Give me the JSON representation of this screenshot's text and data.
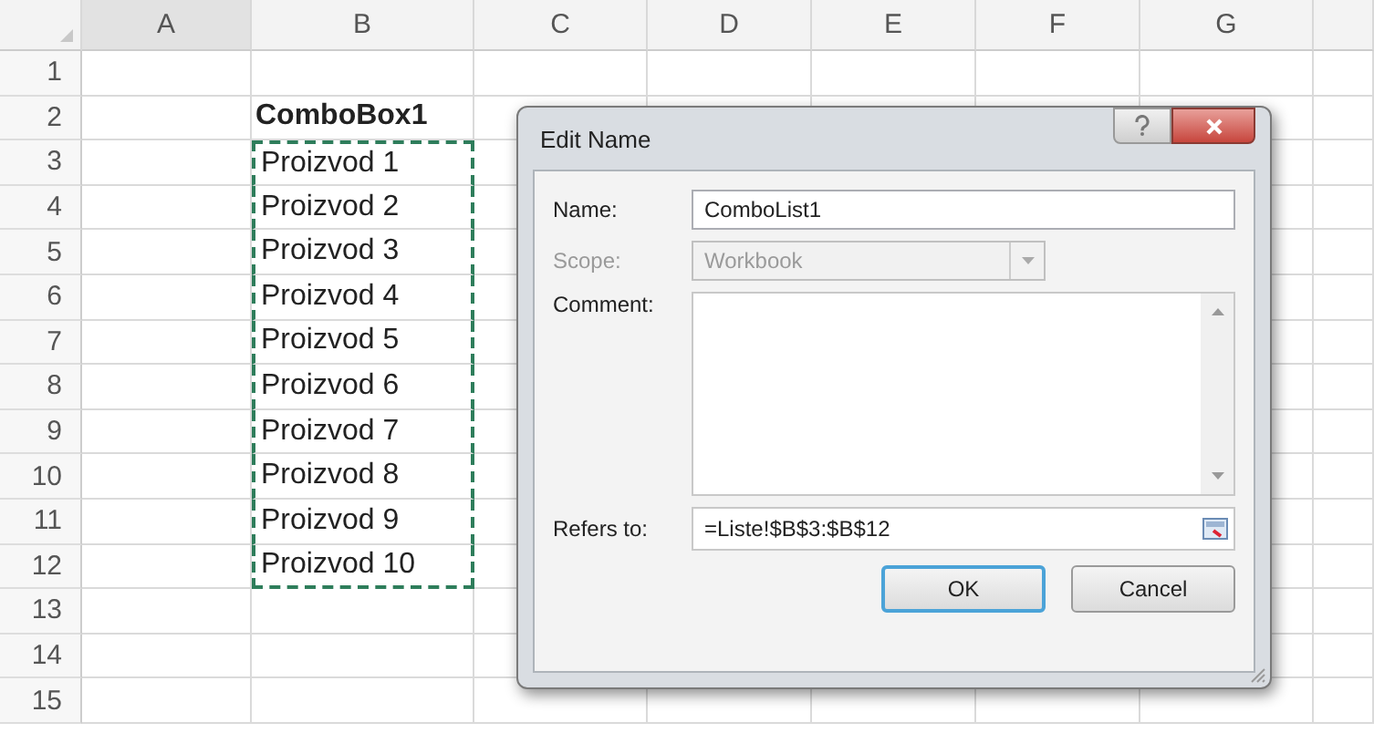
{
  "sheet": {
    "columns": [
      "A",
      "B",
      "C",
      "D",
      "E",
      "F",
      "G"
    ],
    "rows": [
      {
        "number": "1",
        "marked": false
      },
      {
        "number": "2",
        "column_b": "ComboBox1",
        "bold": true,
        "marked": false
      },
      {
        "number": "3",
        "column_b": "Proizvod 1",
        "bold": false,
        "marked": true
      },
      {
        "number": "4",
        "column_b": "Proizvod 2",
        "bold": false,
        "marked": true
      },
      {
        "number": "5",
        "column_b": "Proizvod 3",
        "bold": false,
        "marked": true
      },
      {
        "number": "6",
        "column_b": "Proizvod 4",
        "bold": false,
        "marked": true
      },
      {
        "number": "7",
        "column_b": "Proizvod 5",
        "bold": false,
        "marked": true
      },
      {
        "number": "8",
        "column_b": "Proizvod 6",
        "bold": false,
        "marked": true
      },
      {
        "number": "9",
        "column_b": "Proizvod 7",
        "bold": false,
        "marked": true
      },
      {
        "number": "10",
        "column_b": "Proizvod 8",
        "bold": false,
        "marked": true
      },
      {
        "number": "11",
        "column_b": "Proizvod 9",
        "bold": false,
        "marked": true
      },
      {
        "number": "12",
        "column_b": "Proizvod 10",
        "bold": false,
        "marked": true
      },
      {
        "number": "13",
        "marked": false
      },
      {
        "number": "14",
        "marked": false
      },
      {
        "number": "15",
        "marked": false
      }
    ]
  },
  "dialog": {
    "title": "Edit Name",
    "name": {
      "label": "Name:",
      "value": "ComboList1"
    },
    "scope": {
      "label": "Scope:",
      "value": "Workbook",
      "disabled": true
    },
    "comment": {
      "label": "Comment:"
    },
    "refers_to": {
      "label": "Refers to:",
      "value": "=Liste!$B$3:$B$12"
    },
    "buttons": [
      {
        "label": "OK",
        "default": true
      },
      {
        "label": "Cancel",
        "default": false
      }
    ]
  }
}
